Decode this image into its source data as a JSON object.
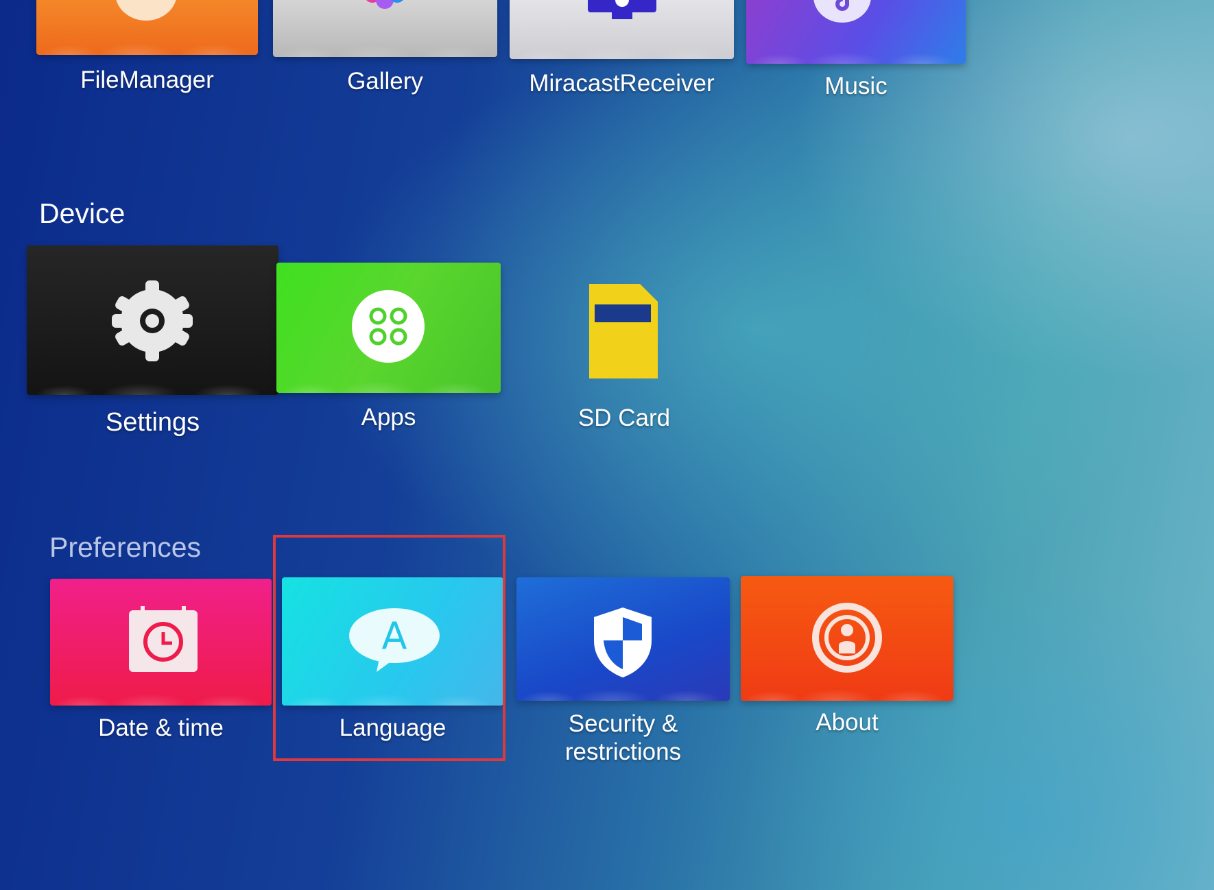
{
  "top_row": {
    "items": [
      {
        "label": "FileManager",
        "icon": "folder-icon"
      },
      {
        "label": "Gallery",
        "icon": "flower-icon"
      },
      {
        "label": "MiracastReceiver",
        "icon": "monitor-icon"
      },
      {
        "label": "Music",
        "icon": "music-note-icon"
      }
    ]
  },
  "device": {
    "title": "Device",
    "items": [
      {
        "label": "Settings",
        "icon": "gear-icon"
      },
      {
        "label": "Apps",
        "icon": "apps-grid-icon"
      },
      {
        "label": "SD Card",
        "icon": "sd-card-icon"
      }
    ]
  },
  "preferences": {
    "title": "Preferences",
    "items": [
      {
        "label": "Date & time",
        "icon": "calendar-clock-icon"
      },
      {
        "label": "Language",
        "icon": "speech-bubble-a-icon",
        "highlighted": true
      },
      {
        "label_line1": "Security &",
        "label_line2": "restrictions",
        "icon": "shield-icon"
      },
      {
        "label": "About",
        "icon": "person-info-icon"
      }
    ]
  },
  "colors": {
    "highlight_border": "#e0383b",
    "filemanager": "#f07c22",
    "gallery": "#c8c8c8",
    "miracast": "#d8d8dc",
    "music": "#6d4ad6",
    "settings": "#1c1c1c",
    "apps": "#4ed12a",
    "sd_card": "#f2d11a",
    "date_time": "#f0185a",
    "language": "#22d0e8",
    "security": "#1c5bd6",
    "about": "#f44410"
  }
}
